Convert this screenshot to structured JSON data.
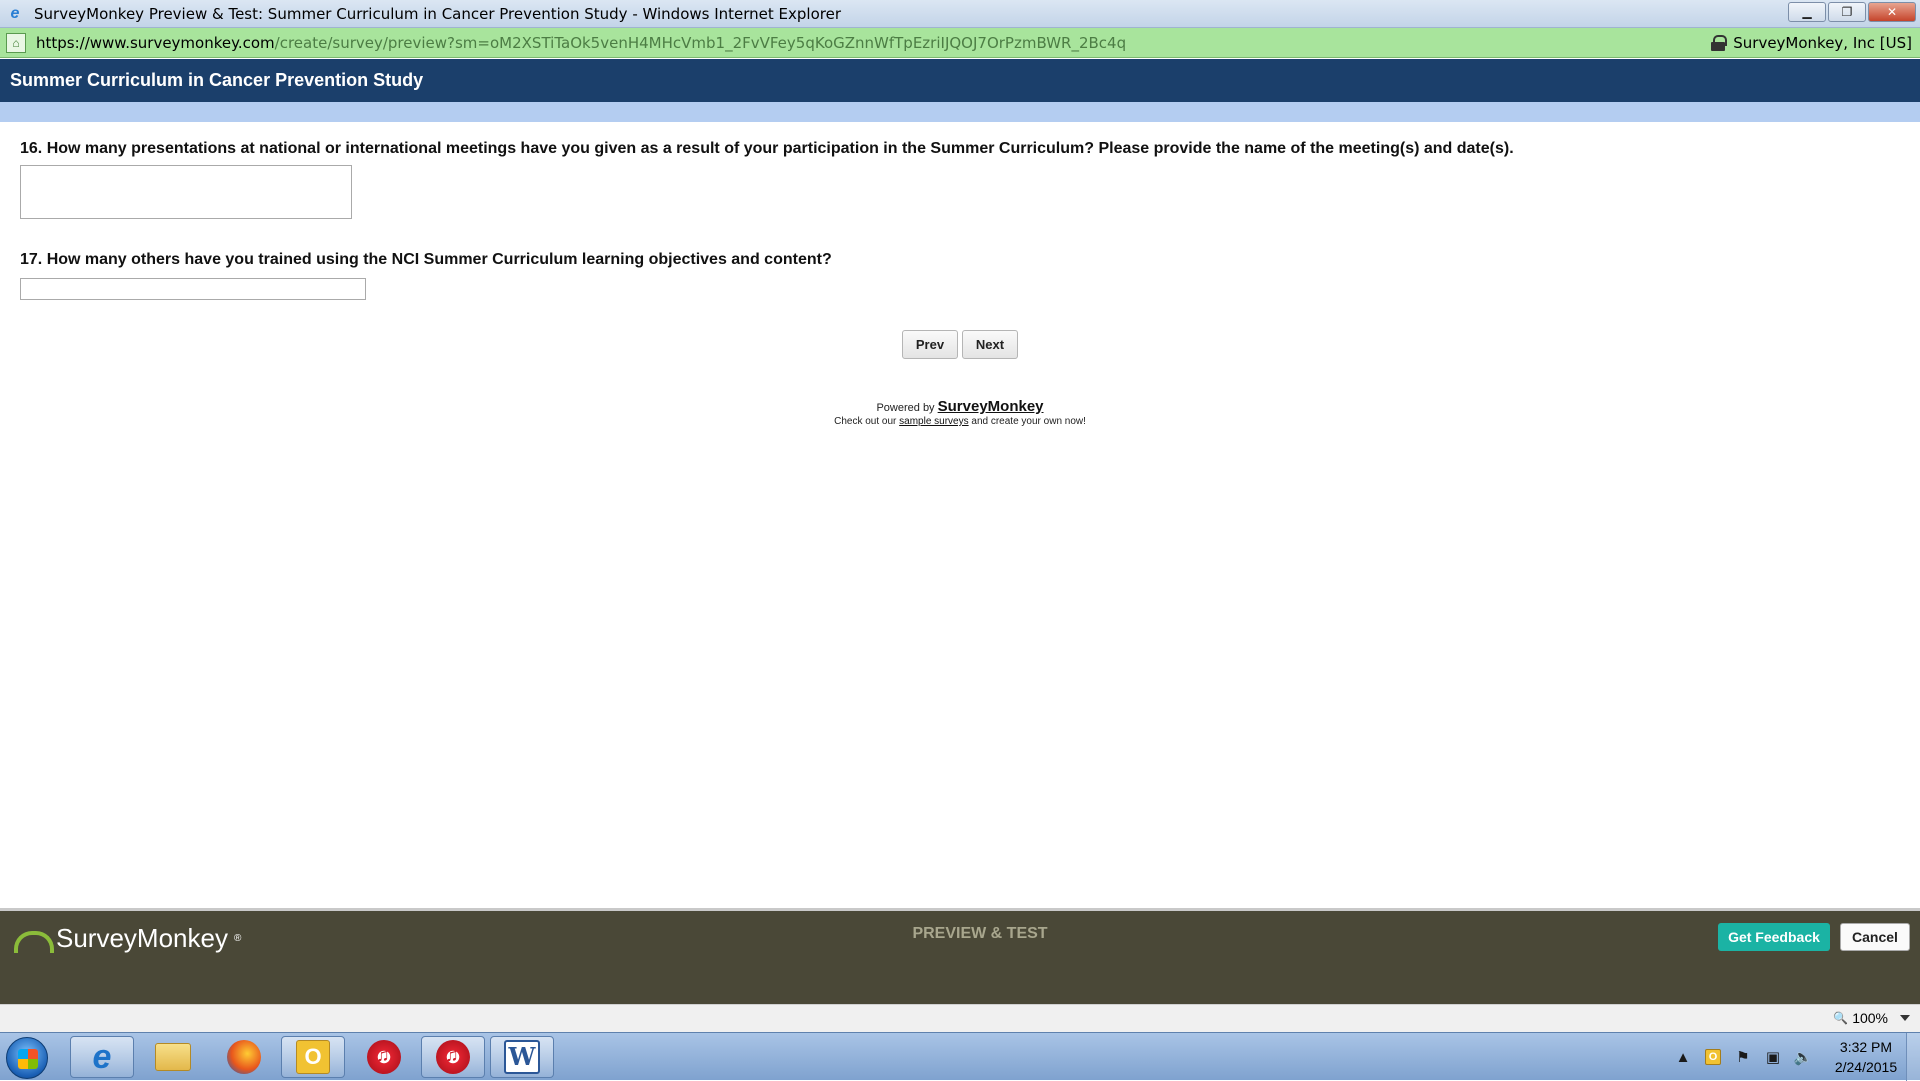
{
  "browser": {
    "window_title": "SurveyMonkey Preview & Test: Summer Curriculum in Cancer Prevention Study - Windows Internet Explorer",
    "url_host": "https://www.surveymonkey.com",
    "url_path": "/create/survey/preview?sm=oM2XSTiTaOk5venH4MHcVmb1_2FvVFey5qKoGZnnWfTpEzriIJQOJ7OrPzmBWR_2Bc4q",
    "cert_label": "SurveyMonkey, Inc [US]",
    "window_buttons": {
      "minimize": "▁",
      "restore": "❐",
      "close": "✕"
    }
  },
  "survey": {
    "title": "Summer Curriculum in Cancer Prevention Study",
    "questions": [
      {
        "label": "16. How many presentations at national or international meetings have you given as a result of your participation in the Summer Curriculum? Please provide the name of the meeting(s) and date(s).",
        "value": ""
      },
      {
        "label": "17. How many others have you trained using the NCI Summer Curriculum learning objectives and content?",
        "value": ""
      }
    ],
    "prev_label": "Prev",
    "next_label": "Next",
    "powered_by": "Powered by",
    "powered_brand": "SurveyMonkey",
    "checkout_prefix": "Check out our",
    "checkout_link": "sample surveys",
    "checkout_suffix": "and create your own now!"
  },
  "preview_bar": {
    "logo_text": "SurveyMonkey",
    "logo_reg": "®",
    "mode_label": "PREVIEW & TEST",
    "feedback_label": "Get Feedback",
    "cancel_label": "Cancel",
    "accent_color": "#1bb3a4"
  },
  "statusbar": {
    "zoom": "100%"
  },
  "taskbar": {
    "apps": [
      "internet-explorer",
      "file-explorer",
      "firefox",
      "outlook",
      "itunes",
      "itunes",
      "word"
    ],
    "outlook_letter": "O",
    "word_letter": "W",
    "ie_letter": "e",
    "time": "3:32 PM",
    "date": "2/24/2015"
  }
}
